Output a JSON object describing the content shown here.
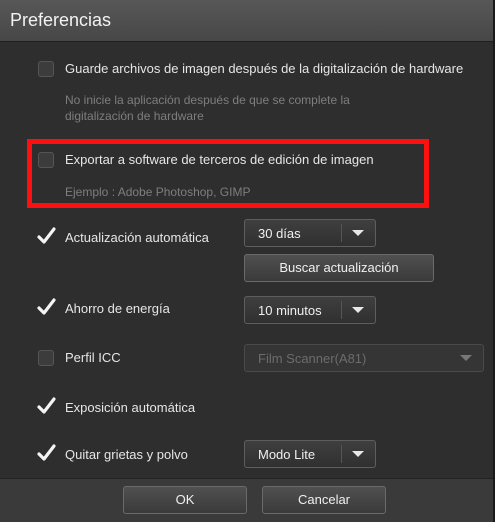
{
  "dialog": {
    "title": "Preferencias"
  },
  "options": {
    "save_after_scan": {
      "label": "Guarde archivos de imagen después de la digitalización de hardware",
      "checked": false,
      "note_line1": "No inicie la aplicación después de que se complete la",
      "note_line2": "digitalización de hardware"
    },
    "export_third_party": {
      "label": "Exportar a software de terceros de edición de imagen",
      "checked": false,
      "note": "Ejemplo : Adobe Photoshop, GIMP"
    },
    "auto_update": {
      "label": "Actualización automática",
      "checked": true,
      "select_value": "30 días",
      "button_label": "Buscar actualización"
    },
    "energy_saving": {
      "label": "Ahorro de energía",
      "checked": true,
      "select_value": "10 minutos"
    },
    "icc_profile": {
      "label": "Perfil ICC",
      "checked": false,
      "select_value": "Film Scanner(A81)"
    },
    "auto_exposure": {
      "label": "Exposición automática",
      "checked": true
    },
    "dust_removal": {
      "label": "Quitar grietas y polvo",
      "checked": true,
      "select_value": "Modo Lite"
    }
  },
  "footer": {
    "ok_label": "OK",
    "cancel_label": "Cancelar"
  },
  "colors": {
    "highlight_border": "#ff1010",
    "dialog_bg": "#2e2e2e",
    "titlebar_bg": "#4f4f4f"
  }
}
